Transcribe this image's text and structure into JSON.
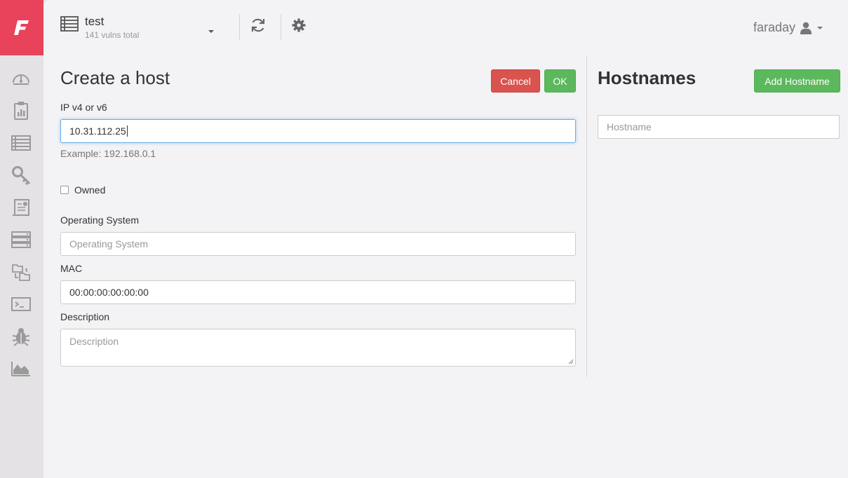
{
  "app": {
    "logo_letter": "F",
    "brand_color": "#e8435a"
  },
  "sidebar": {
    "items": [
      {
        "icon": "dashboard-icon"
      },
      {
        "icon": "status-report-icon"
      },
      {
        "icon": "hosts-list-icon"
      },
      {
        "icon": "credentials-key-icon"
      },
      {
        "icon": "executive-report-icon"
      },
      {
        "icon": "servers-icon"
      },
      {
        "icon": "workspaces-transfer-icon"
      },
      {
        "icon": "terminal-icon"
      },
      {
        "icon": "bug-icon"
      },
      {
        "icon": "analytics-chart-icon"
      }
    ]
  },
  "header": {
    "workspace_name": "test",
    "workspace_vulns": "141 vulns total",
    "user_name": "faraday"
  },
  "form": {
    "title": "Create a host",
    "cancel_label": "Cancel",
    "ok_label": "OK",
    "ip_label": "IP v4 or v6",
    "ip_value": "10.31.112.25",
    "ip_help": "Example: 192.168.0.1",
    "owned_label": "Owned",
    "owned_checked": false,
    "os_label": "Operating System",
    "os_placeholder": "Operating System",
    "mac_label": "MAC",
    "mac_value": "00:00:00:00:00:00",
    "description_label": "Description",
    "description_placeholder": "Description"
  },
  "hostnames": {
    "title": "Hostnames",
    "add_label": "Add Hostname",
    "input_placeholder": "Hostname"
  }
}
